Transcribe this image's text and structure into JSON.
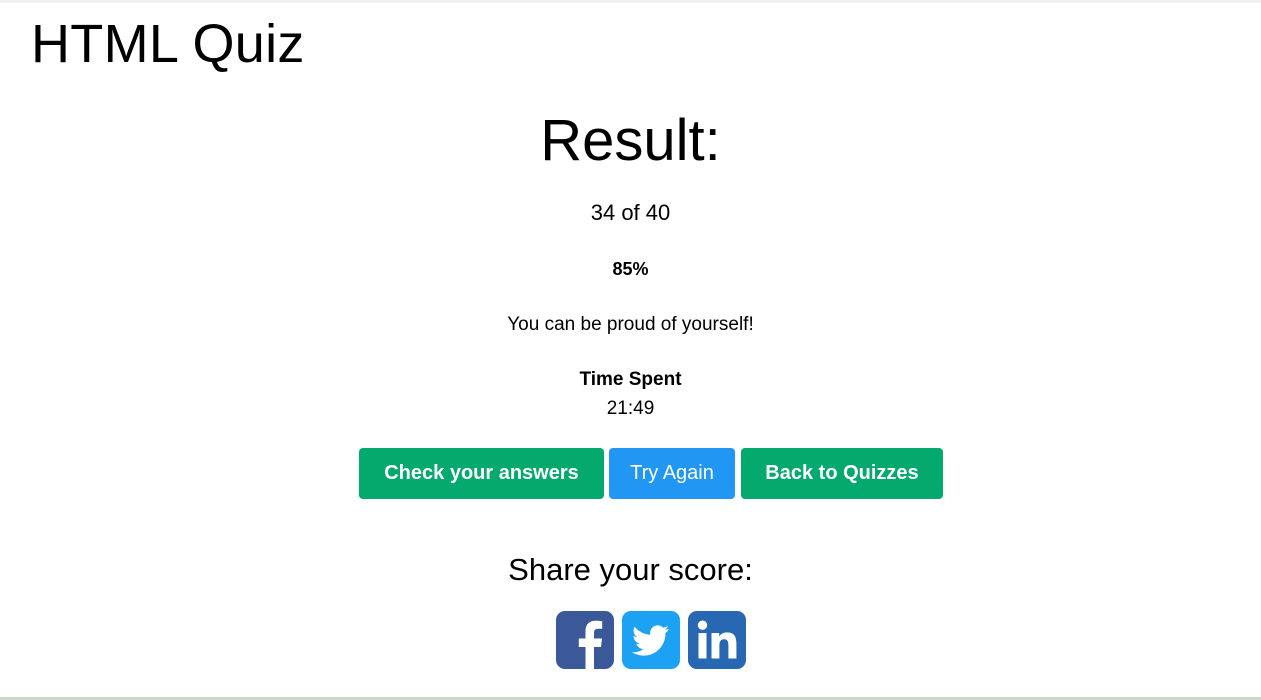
{
  "page": {
    "title": "HTML Quiz"
  },
  "result": {
    "heading": "Result:",
    "score_text": "34 of 40",
    "score_correct": 34,
    "score_total": 40,
    "percent": "85%",
    "message": "You can be proud of yourself!",
    "time_label": "Time Spent",
    "time_value": "21:49"
  },
  "actions": {
    "check_answers": "Check your answers",
    "try_again": "Try Again",
    "back_to_quizzes": "Back to Quizzes"
  },
  "share": {
    "heading": "Share your score:",
    "networks": [
      {
        "name": "Facebook",
        "icon": "facebook-icon",
        "color": "#3b5998"
      },
      {
        "name": "Twitter",
        "icon": "twitter-icon",
        "color": "#1da1f2"
      },
      {
        "name": "LinkedIn",
        "icon": "linkedin-icon",
        "color": "#2867b2"
      }
    ]
  },
  "colors": {
    "green": "#04aa6d",
    "blue": "#2196f3"
  }
}
